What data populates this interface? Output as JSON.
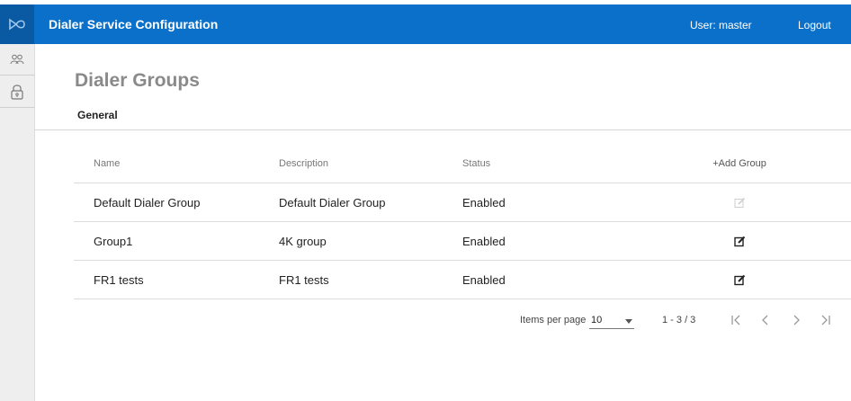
{
  "header": {
    "title": "Dialer Service Configuration",
    "user_label": "User:  master",
    "logout_label": "Logout",
    "color": "#0b70c9"
  },
  "sidebar": {
    "items": [
      {
        "icon": "users-icon"
      },
      {
        "icon": "lock-icon"
      }
    ]
  },
  "page": {
    "title": "Dialer Groups",
    "tab": "General"
  },
  "table": {
    "columns": [
      "Name",
      "Description",
      "Status"
    ],
    "add_label": "+Add Group",
    "rows": [
      {
        "name": "Default Dialer Group",
        "description": "Default Dialer Group",
        "status": "Enabled",
        "editable": false
      },
      {
        "name": "Group1",
        "description": "4K group",
        "status": "Enabled",
        "editable": true
      },
      {
        "name": "FR1 tests",
        "description": "FR1 tests",
        "status": "Enabled",
        "editable": true
      }
    ]
  },
  "pagination": {
    "items_per_page_label": "Items per page",
    "items_per_page": "10",
    "range": "1 - 3 / 3"
  }
}
